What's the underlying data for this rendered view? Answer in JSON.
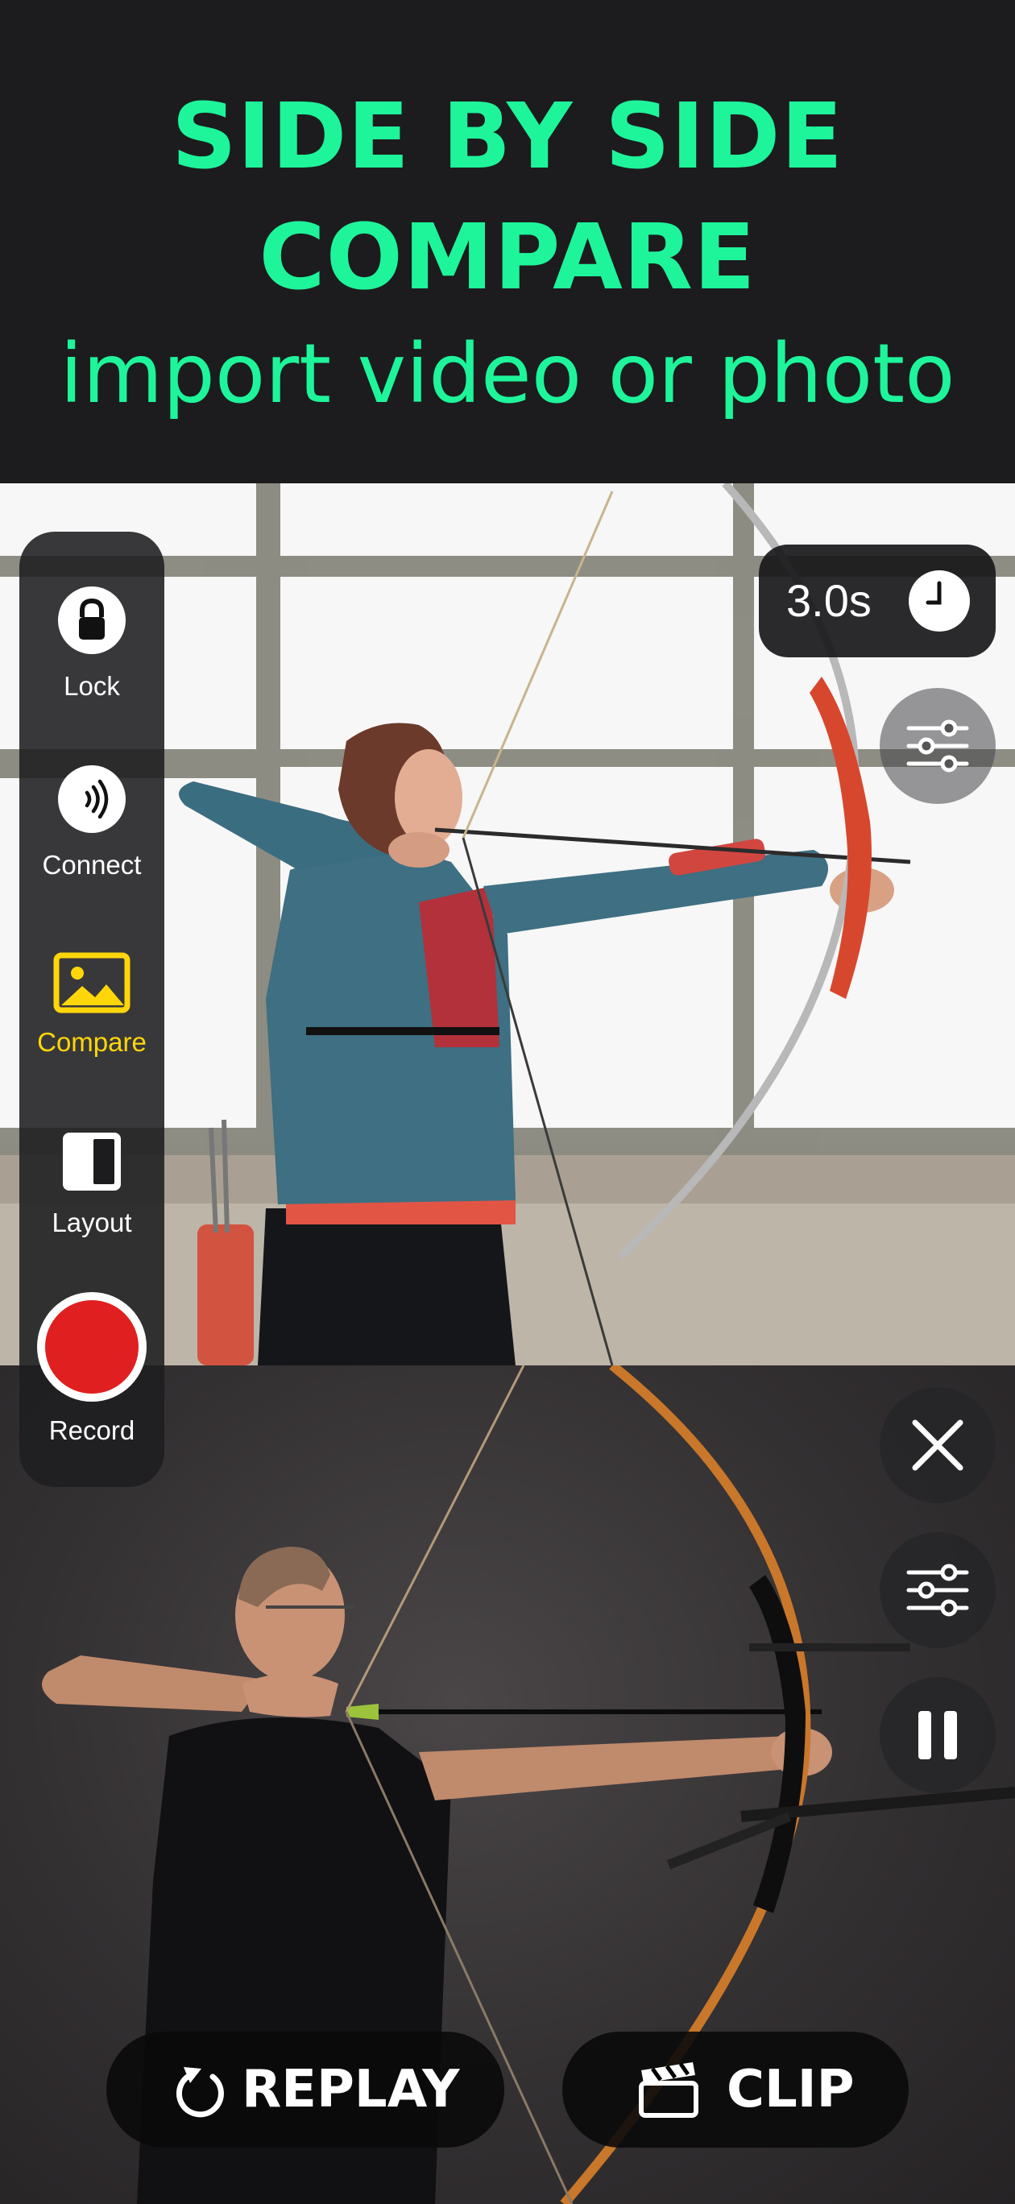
{
  "header": {
    "line1": "SIDE BY SIDE",
    "line2": "COMPARE",
    "subtitle": "import video or photo",
    "accent_color": "#1ef59a"
  },
  "rail": {
    "items": [
      {
        "label": "Lock",
        "icon": "lock-icon",
        "active": false
      },
      {
        "label": "Connect",
        "icon": "connect-icon",
        "active": false
      },
      {
        "label": "Compare",
        "icon": "photo-icon",
        "active": true
      },
      {
        "label": "Layout",
        "icon": "split-layout-icon",
        "active": false
      },
      {
        "label": "Record",
        "icon": "record-button",
        "active": false
      }
    ],
    "active_color": "#ffd60a",
    "record_color": "#e02020"
  },
  "timer": {
    "value": "3.0s",
    "icon": "clock-icon"
  },
  "controls": {
    "top_pane": [
      "sliders-icon"
    ],
    "bottom_pane": [
      "close-icon",
      "sliders-icon",
      "pause-icon"
    ]
  },
  "actions": {
    "replay": {
      "label": "REPLAY",
      "icon": "replay-icon"
    },
    "clip": {
      "label": "CLIP",
      "icon": "clapperboard-icon"
    }
  },
  "images": {
    "top": "woman archer drawing recurve bow in front of industrial windows",
    "bottom": "man archer drawing recurve bow against dark studio background"
  }
}
